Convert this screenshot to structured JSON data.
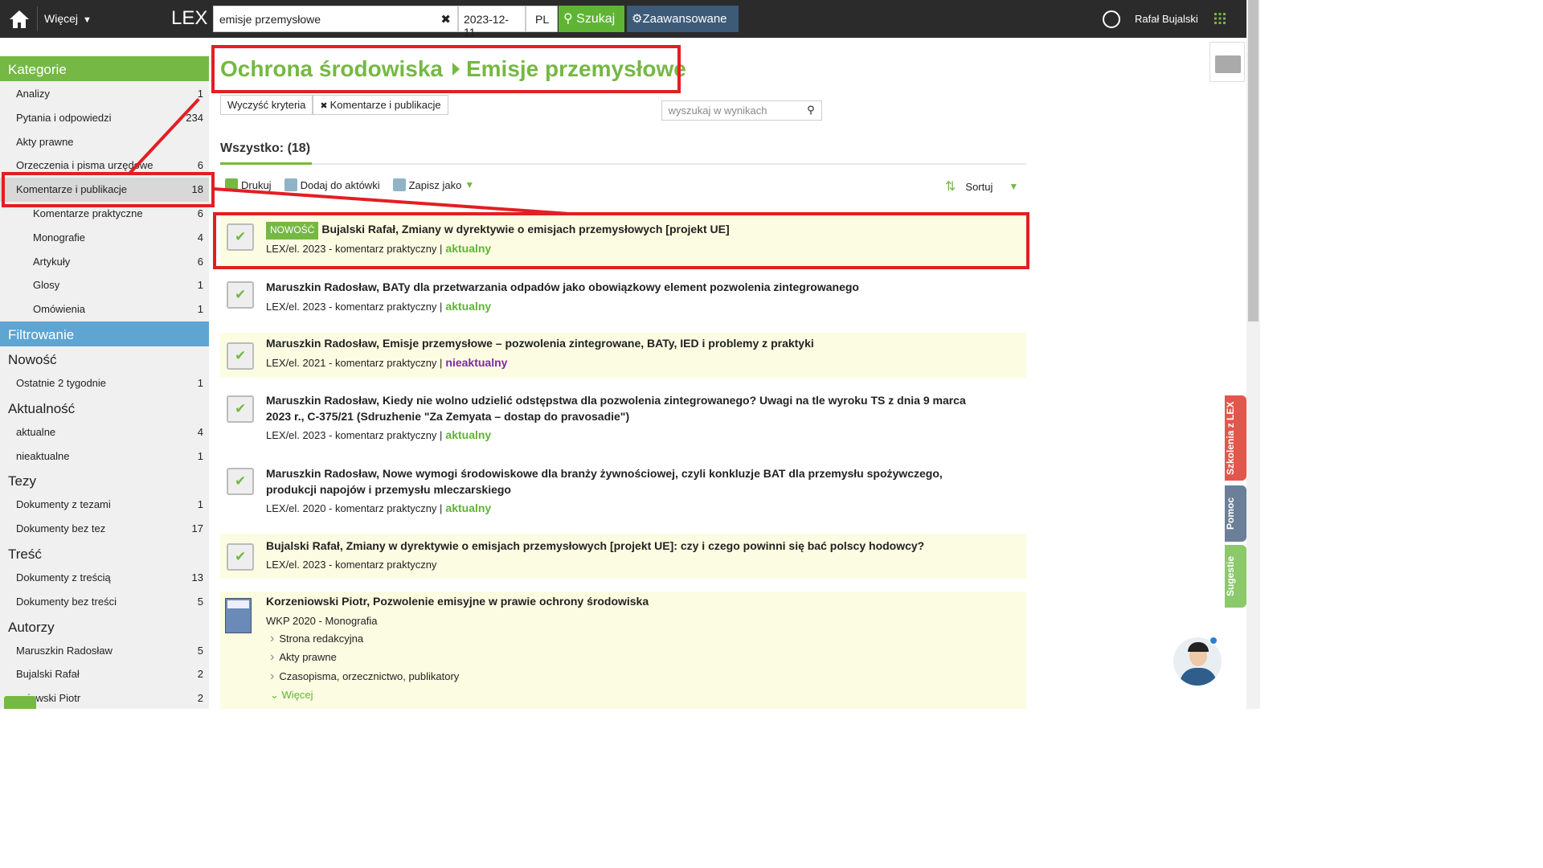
{
  "topbar": {
    "more_label": "Więcej",
    "logo": "LEX",
    "search_value": "emisje przemysłowe",
    "date": "2023-12-11",
    "lang": "PL",
    "search_button": "Szukaj",
    "advanced_button": "Zaawansowane",
    "user": "Rafał Bujalski"
  },
  "sidebar": {
    "categories_title": "Kategorie",
    "categories": [
      {
        "label": "Analizy",
        "count": "1"
      },
      {
        "label": "Pytania i odpowiedzi",
        "count": "234"
      },
      {
        "label": "Akty prawne",
        "count": ""
      },
      {
        "label": "Orzeczenia i pisma urzędowe",
        "count": "6"
      },
      {
        "label": "Komentarze i publikacje",
        "count": "18"
      },
      {
        "label": "Komentarze praktyczne",
        "count": "6"
      },
      {
        "label": "Monografie",
        "count": "4"
      },
      {
        "label": "Artykuły",
        "count": "6"
      },
      {
        "label": "Glosy",
        "count": "1"
      },
      {
        "label": "Omówienia",
        "count": "1"
      }
    ],
    "filter_title": "Filtrowanie",
    "sections": [
      {
        "title": "Nowość",
        "items": [
          {
            "label": "Ostatnie 2 tygodnie",
            "count": "1"
          }
        ]
      },
      {
        "title": "Aktualność",
        "items": [
          {
            "label": "aktualne",
            "count": "4"
          },
          {
            "label": "nieaktualne",
            "count": "1"
          }
        ]
      },
      {
        "title": "Tezy",
        "items": [
          {
            "label": "Dokumenty z tezami",
            "count": "1"
          },
          {
            "label": "Dokumenty bez tez",
            "count": "17"
          }
        ]
      },
      {
        "title": "Treść",
        "items": [
          {
            "label": "Dokumenty z treścią",
            "count": "13"
          },
          {
            "label": "Dokumenty bez treści",
            "count": "5"
          }
        ]
      },
      {
        "title": "Autorzy",
        "items": [
          {
            "label": "Maruszkin Radosław",
            "count": "5"
          },
          {
            "label": "Bujalski Rafał",
            "count": "2"
          },
          {
            "label": "eniowski Piotr",
            "count": "2"
          }
        ]
      }
    ]
  },
  "main": {
    "title_part1": "Ochrona środowiska",
    "title_part2": "Emisje przemysłowe",
    "clear_filters": "Wyczyść kryteria",
    "active_filter": "Komentarze i publikacje",
    "search_results_placeholder": "wyszukaj w wynikach",
    "all_label": "Wszystko: (18)",
    "toolbar": {
      "print": "Drukuj",
      "add": "Dodaj do aktówki",
      "save": "Zapisz jako",
      "sort": "Sortuj"
    },
    "results": [
      {
        "badge": "NOWOŚĆ",
        "title": "Bujalski Rafał, Zmiany w dyrektywie o emisjach przemysłowych [projekt UE]",
        "meta": "LEX/el. 2023 - komentarz praktyczny |",
        "status": "aktualny"
      },
      {
        "title": "Maruszkin Radosław, BATy dla przetwarzania odpadów jako obowiązkowy element pozwolenia zintegrowanego",
        "meta": "LEX/el. 2023 - komentarz praktyczny |",
        "status": "aktualny"
      },
      {
        "title": "Maruszkin Radosław, Emisje przemysłowe – pozwolenia zintegrowane, BATy, IED i problemy z praktyki",
        "meta": "LEX/el. 2021 - komentarz praktyczny |",
        "status": "nieaktualny"
      },
      {
        "title_line1": "Maruszkin Radosław, Kiedy nie wolno udzielić odstępstwa dla pozwolenia zintegrowanego? Uwagi na tle wyroku TS z dnia 9 marca",
        "title_line2": "2023 r., C-375/21 (Sdruzhenie \"Za Zemyata – dostap do pravosadie\")",
        "meta": "LEX/el. 2023 - komentarz praktyczny |",
        "status": "aktualny"
      },
      {
        "title_line1": "Maruszkin Radosław, Nowe wymogi środowiskowe dla branży żywnościowej, czyli konkluzje BAT dla przemysłu spożywczego,",
        "title_line2": "produkcji napojów i przemysłu mleczarskiego",
        "meta": "LEX/el. 2020 - komentarz praktyczny |",
        "status": "aktualny"
      },
      {
        "title": "Bujalski Rafał, Zmiany w dyrektywie o emisjach przemysłowych [projekt UE]: czy i czego powinni się bać polscy hodowcy?",
        "meta": "LEX/el. 2023 - komentarz praktyczny"
      },
      {
        "title": "Korzeniowski Piotr, Pozwolenie emisyjne w prawie ochrony środowiska",
        "meta": "WKP 2020 - Monografia",
        "links": [
          "Strona redakcyjna",
          "Akty prawne",
          "Czasopisma, orzecznictwo, publikatory"
        ],
        "more": "Więcej"
      }
    ]
  },
  "sidetabs": {
    "training": "Szkolenia z LEX",
    "help": "Pomoc",
    "suggestions": "Sugestie"
  },
  "colors": {
    "accent_green": "#75b843",
    "topbar": "#2b2b2b",
    "highlight": "#e31e24",
    "filter_blue": "#5ea5d1"
  }
}
